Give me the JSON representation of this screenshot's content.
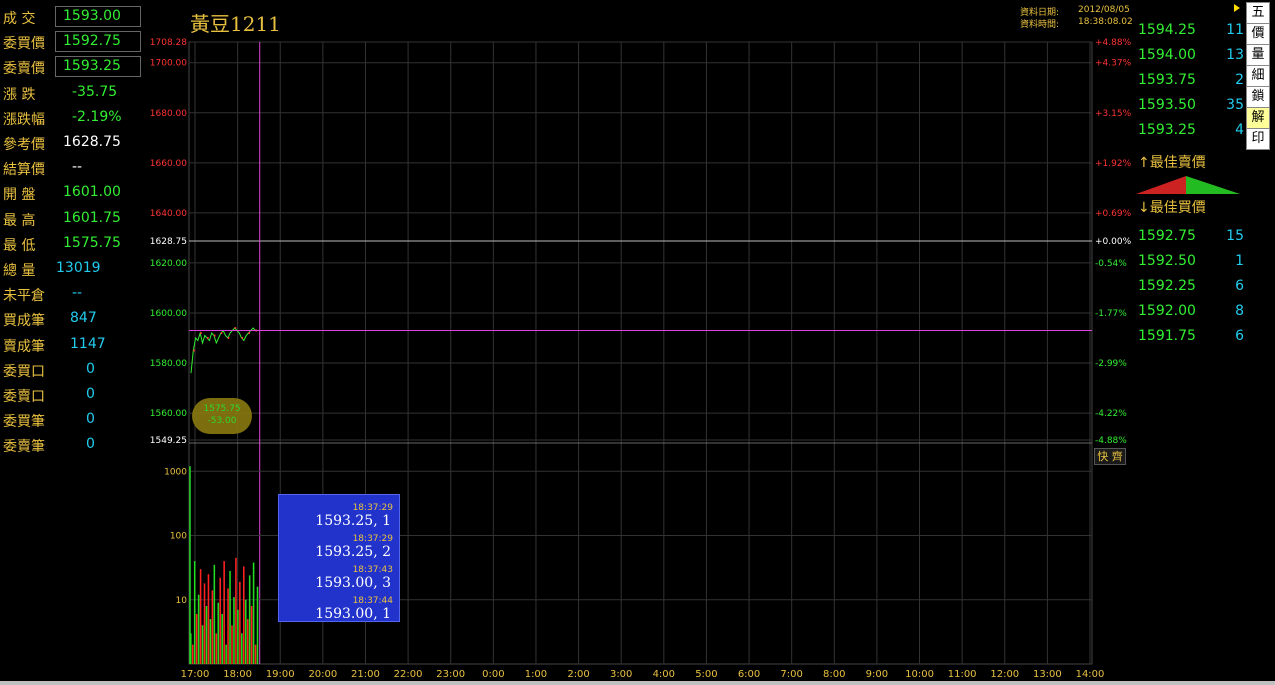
{
  "title": "黃豆1211",
  "header": {
    "date_label": "資料日期:",
    "date_value": "2012/08/05",
    "time_label": "資料時間:",
    "time_value": "18:38:08.02"
  },
  "quote": [
    {
      "label": "成 交",
      "value": "1593.00",
      "color": "green",
      "boxed": true
    },
    {
      "label": "委買價",
      "value": "1592.75",
      "color": "green",
      "boxed": true
    },
    {
      "label": "委賣價",
      "value": "1593.25",
      "color": "green",
      "boxed": true
    },
    {
      "label": "漲 跌",
      "value": "-35.75",
      "color": "green",
      "boxed": false
    },
    {
      "label": "漲跌幅",
      "value": "-2.19%",
      "color": "green",
      "boxed": false
    },
    {
      "label": "參考價",
      "value": "1628.75",
      "color": "white",
      "boxed": false
    },
    {
      "label": "結算價",
      "value": "--",
      "color": "white",
      "boxed": false
    },
    {
      "label": "開 盤",
      "value": "1601.00",
      "color": "green",
      "boxed": false
    },
    {
      "label": "最 高",
      "value": "1601.75",
      "color": "green",
      "boxed": false
    },
    {
      "label": "最 低",
      "value": "1575.75",
      "color": "green",
      "boxed": false
    },
    {
      "label": "總 量",
      "value": "13019",
      "color": "cyan",
      "boxed": false
    },
    {
      "label": "未平倉",
      "value": "--",
      "color": "cyan",
      "boxed": false
    },
    {
      "label": "買成筆",
      "value": "847",
      "color": "cyan",
      "boxed": false
    },
    {
      "label": "賣成筆",
      "value": "1147",
      "color": "cyan",
      "boxed": false
    },
    {
      "label": "委買口",
      "value": "0",
      "color": "cyan",
      "boxed": false
    },
    {
      "label": "委賣口",
      "value": "0",
      "color": "cyan",
      "boxed": false
    },
    {
      "label": "委買筆",
      "value": "0",
      "color": "cyan",
      "boxed": false
    },
    {
      "label": "委賣筆",
      "value": "0",
      "color": "cyan",
      "boxed": false
    }
  ],
  "ask_book": [
    {
      "price": "1594.25",
      "qty": "11"
    },
    {
      "price": "1594.00",
      "qty": "13"
    },
    {
      "price": "1593.75",
      "qty": "2"
    },
    {
      "price": "1593.50",
      "qty": "35"
    },
    {
      "price": "1593.25",
      "qty": "4"
    }
  ],
  "best_ask_label": "↑最佳賣價",
  "best_bid_label": "↓最佳買價",
  "bid_book": [
    {
      "price": "1592.75",
      "qty": "15"
    },
    {
      "price": "1592.50",
      "qty": "1"
    },
    {
      "price": "1592.25",
      "qty": "6"
    },
    {
      "price": "1592.00",
      "qty": "8"
    },
    {
      "price": "1591.75",
      "qty": "6"
    }
  ],
  "side_buttons": [
    {
      "label": "五",
      "active": false
    },
    {
      "label": "價",
      "active": false
    },
    {
      "label": "量",
      "active": false
    },
    {
      "label": "細",
      "active": false
    },
    {
      "label": "鎖",
      "active": false
    },
    {
      "label": "解",
      "active": true
    },
    {
      "label": "印",
      "active": false
    }
  ],
  "quick_label": "快 齊",
  "low_marker": {
    "price": "1575.75",
    "change": "-53.00"
  },
  "ticker": [
    {
      "time": "18:37:29",
      "text": "1593.25,   1"
    },
    {
      "time": "18:37:29",
      "text": "1593.25,   2"
    },
    {
      "time": "18:37:43",
      "text": "1593.00,   3"
    },
    {
      "time": "18:37:44",
      "text": "1593.00,   1"
    }
  ],
  "colors": {
    "background": "#000000",
    "grid": "#333333",
    "crosshair": "#dd44dd",
    "label_gold": "#e8c040",
    "price_up": "#ff3333",
    "price_down": "#33ee33",
    "value_cyan": "#22ccee"
  },
  "chart_data": [
    {
      "type": "line",
      "title": "黃豆1211",
      "price_axis_left": [
        {
          "label": "1708.28",
          "value": 1708.28,
          "color": "red"
        },
        {
          "label": "1700.00",
          "value": 1700,
          "color": "red"
        },
        {
          "label": "1680.00",
          "value": 1680,
          "color": "red"
        },
        {
          "label": "1660.00",
          "value": 1660,
          "color": "red"
        },
        {
          "label": "1640.00",
          "value": 1640,
          "color": "red"
        },
        {
          "label": "1628.75",
          "value": 1628.75,
          "color": "white"
        },
        {
          "label": "1620.00",
          "value": 1620,
          "color": "green"
        },
        {
          "label": "1600.00",
          "value": 1600,
          "color": "green"
        },
        {
          "label": "1580.00",
          "value": 1580,
          "color": "green"
        },
        {
          "label": "1560.00",
          "value": 1560,
          "color": "green"
        },
        {
          "label": "1549.25",
          "value": 1549.25,
          "color": "white"
        }
      ],
      "percent_axis_right": [
        {
          "label": "+4.88%",
          "value": 1708.28,
          "color": "red"
        },
        {
          "label": "+4.37%",
          "value": 1700,
          "color": "red"
        },
        {
          "label": "+3.15%",
          "value": 1680,
          "color": "red"
        },
        {
          "label": "+1.92%",
          "value": 1660,
          "color": "red"
        },
        {
          "label": "+0.69%",
          "value": 1640,
          "color": "red"
        },
        {
          "label": "+0.00%",
          "value": 1628.75,
          "color": "white"
        },
        {
          "label": "-0.54%",
          "value": 1620,
          "color": "green"
        },
        {
          "label": "-1.77%",
          "value": 1600,
          "color": "green"
        },
        {
          "label": "-2.99%",
          "value": 1580,
          "color": "green"
        },
        {
          "label": "-4.22%",
          "value": 1560,
          "color": "green"
        },
        {
          "label": "-4.88%",
          "value": 1549.25,
          "color": "green"
        }
      ],
      "ylim": [
        1549.25,
        1708.28
      ],
      "reference": 1628.75,
      "x_ticks": [
        "17:00",
        "18:00",
        "19:00",
        "20:00",
        "21:00",
        "22:00",
        "23:00",
        "0:00",
        "1:00",
        "2:00",
        "3:00",
        "4:00",
        "5:00",
        "6:00",
        "7:00",
        "8:00",
        "9:00",
        "10:00",
        "11:00",
        "12:00",
        "13:00",
        "14:00"
      ],
      "price_series": [
        1576,
        1585,
        1590,
        1589,
        1592,
        1588,
        1591,
        1590,
        1589,
        1592,
        1591,
        1588,
        1590,
        1592,
        1593,
        1591,
        1590,
        1592,
        1593,
        1594,
        1593,
        1592,
        1590,
        1589,
        1591,
        1592,
        1593,
        1594,
        1593,
        1593
      ],
      "crosshair_price": 1593.0,
      "grid": true
    },
    {
      "type": "bar",
      "scale": "log",
      "y_ticks": [
        "1000",
        "100",
        "10"
      ],
      "volume_series": [
        {
          "v": 3,
          "c": "green"
        },
        {
          "v": 2,
          "c": "red"
        },
        {
          "v": 40,
          "c": "green"
        },
        {
          "v": 6,
          "c": "red"
        },
        {
          "v": 12,
          "c": "green"
        },
        {
          "v": 30,
          "c": "red"
        },
        {
          "v": 4,
          "c": "green"
        },
        {
          "v": 18,
          "c": "red"
        },
        {
          "v": 8,
          "c": "green"
        },
        {
          "v": 25,
          "c": "red"
        },
        {
          "v": 5,
          "c": "green"
        },
        {
          "v": 14,
          "c": "red"
        },
        {
          "v": 35,
          "c": "green"
        },
        {
          "v": 3,
          "c": "red"
        },
        {
          "v": 9,
          "c": "green"
        },
        {
          "v": 22,
          "c": "red"
        },
        {
          "v": 6,
          "c": "green"
        },
        {
          "v": 40,
          "c": "red"
        },
        {
          "v": 2,
          "c": "green"
        },
        {
          "v": 15,
          "c": "red"
        },
        {
          "v": 28,
          "c": "green"
        },
        {
          "v": 4,
          "c": "red"
        },
        {
          "v": 11,
          "c": "green"
        },
        {
          "v": 45,
          "c": "red"
        },
        {
          "v": 7,
          "c": "green"
        },
        {
          "v": 19,
          "c": "red"
        },
        {
          "v": 3,
          "c": "green"
        },
        {
          "v": 33,
          "c": "red"
        },
        {
          "v": 10,
          "c": "green"
        },
        {
          "v": 5,
          "c": "red"
        },
        {
          "v": 24,
          "c": "green"
        },
        {
          "v": 8,
          "c": "red"
        },
        {
          "v": 38,
          "c": "green"
        },
        {
          "v": 2,
          "c": "red"
        },
        {
          "v": 16,
          "c": "green"
        }
      ]
    }
  ]
}
